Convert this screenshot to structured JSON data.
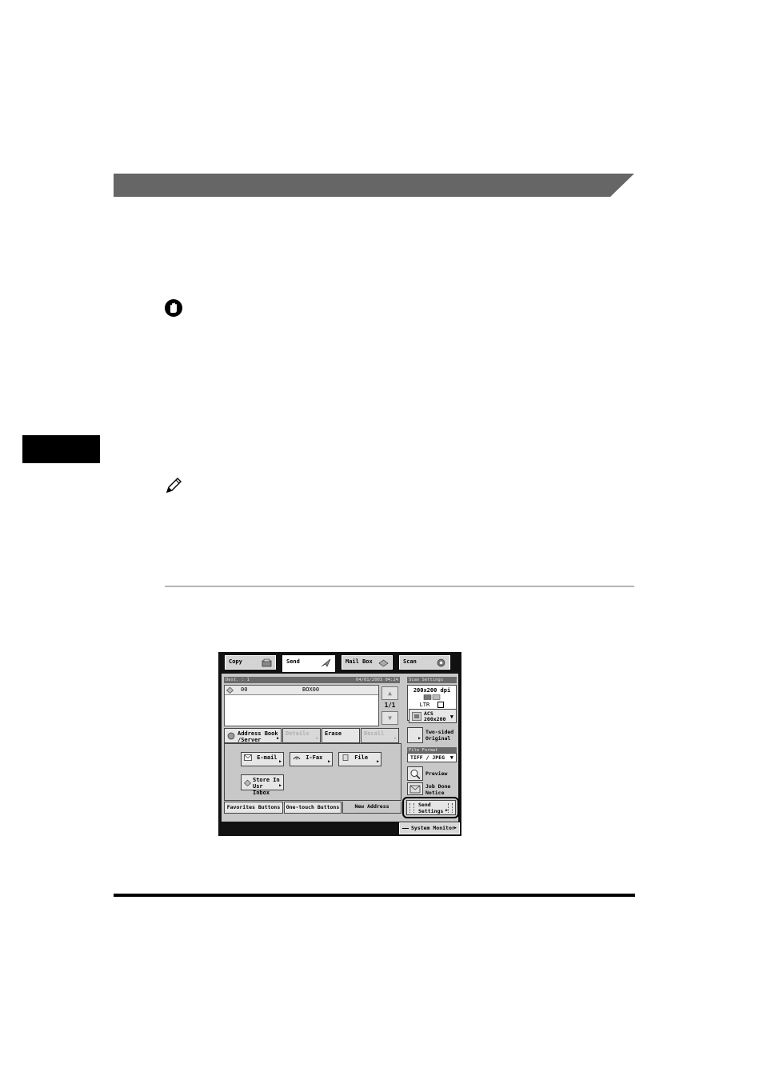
{
  "panel": {
    "tabs": [
      {
        "label": "Copy",
        "icon": "copy-icon"
      },
      {
        "label": "Send",
        "icon": "send-icon"
      },
      {
        "label": "Mail Box",
        "icon": "mailbox-icon"
      },
      {
        "label": "Scan",
        "icon": "scan-icon"
      }
    ],
    "dest_header": {
      "left": "Dest. :  1",
      "right": "04/01/2003 04:24"
    },
    "dest_row": {
      "index": "00",
      "name": "BOX00"
    },
    "page_indicator": "1/1",
    "dest_buttons": {
      "address_book": "Address Book /Server",
      "details": "Details",
      "erase": "Erase",
      "recall": "Recall"
    },
    "new_address_buttons": {
      "email": "E-mail",
      "ifax": "I-Fax",
      "file": "File",
      "store_in_user_inbox": "Store In Usr Inbox"
    },
    "bottom_tabs": {
      "favorites": "Favorites Buttons",
      "one_touch": "One-touch Buttons",
      "new_address": "New Address"
    },
    "scan_settings": {
      "label": "Scan Settings",
      "resolution": "200x200 dpi",
      "size": "LTR",
      "mode_line1": "ACS",
      "mode_line2": "200x200"
    },
    "two_sided": "Two-sided Original",
    "file_format": {
      "label": "File Format",
      "value": "TIFF / JPEG"
    },
    "preview": "Preview",
    "job_done": "Job Done Notice",
    "send_settings": "Send Settings",
    "system_monitor": "System Monitor"
  }
}
